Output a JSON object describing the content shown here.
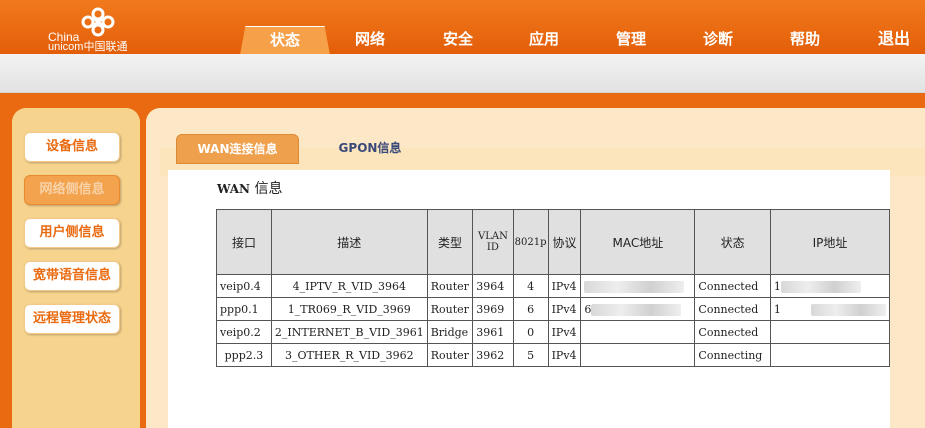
{
  "brand": {
    "line1": "China",
    "line2": "unicom中国联通",
    "colors": {
      "header": "#e86a12",
      "tab_active": "#f6a14a",
      "accent": "#e96a10"
    }
  },
  "nav": {
    "items": [
      {
        "label": "状态",
        "active": true
      },
      {
        "label": "网络"
      },
      {
        "label": "安全"
      },
      {
        "label": "应用"
      },
      {
        "label": "管理"
      },
      {
        "label": "诊断"
      },
      {
        "label": "帮助"
      }
    ],
    "logout": "退出"
  },
  "sidebar": {
    "items": [
      {
        "label": "设备信息"
      },
      {
        "label": "网络侧信息",
        "active": true
      },
      {
        "label": "用户侧信息"
      },
      {
        "label": "宽带语音信息"
      },
      {
        "label": "远程管理状态"
      }
    ]
  },
  "tabs": [
    {
      "label": "WAN连接信息",
      "active": true
    },
    {
      "label": "GPON信息"
    }
  ],
  "section": {
    "title_prefix": "WAN",
    "title_suffix": " 信息"
  },
  "table": {
    "headers": {
      "iface": "接口",
      "desc": "描述",
      "type": "类型",
      "vlan": "VLAN ID",
      "p8021": "8021p",
      "proto": "协议",
      "mac": "MAC地址",
      "status": "状态",
      "ip": "IP地址"
    },
    "rows": [
      {
        "iface": "veip0.4",
        "desc": "4_IPTV_R_VID_3964",
        "type": "Router",
        "vlan": "3964",
        "p8021": "4",
        "proto": "IPv4",
        "mac": "",
        "status": "Connected",
        "ip": "1"
      },
      {
        "iface": "ppp0.1",
        "desc": "1_TR069_R_VID_3969",
        "type": "Router",
        "vlan": "3969",
        "p8021": "6",
        "proto": "IPv4",
        "mac": "6",
        "status": "Connected",
        "ip": "1"
      },
      {
        "iface": "veip0.2",
        "desc": "2_INTERNET_B_VID_3961",
        "type": "Bridge",
        "vlan": "3961",
        "p8021": "0",
        "proto": "IPv4",
        "mac": "",
        "status": "Connected",
        "ip": ""
      },
      {
        "iface": "ppp2.3",
        "desc": "3_OTHER_R_VID_3962",
        "type": "Router",
        "vlan": "3962",
        "p8021": "5",
        "proto": "IPv4",
        "mac": "",
        "status": "Connecting",
        "ip": ""
      }
    ]
  }
}
